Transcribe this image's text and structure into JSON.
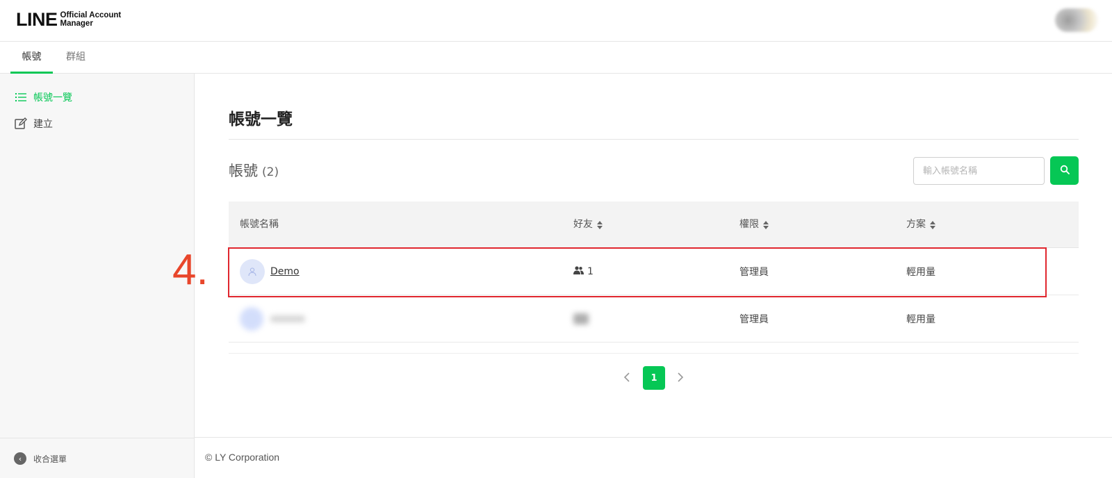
{
  "header": {
    "logo_main": "LINE",
    "logo_sub_line1": "Official Account",
    "logo_sub_line2": "Manager"
  },
  "tabs": [
    {
      "label": "帳號",
      "active": true
    },
    {
      "label": "群組",
      "active": false
    }
  ],
  "sidebar": {
    "items": [
      {
        "label": "帳號一覽",
        "icon": "list-icon",
        "active": true
      },
      {
        "label": "建立",
        "icon": "edit-icon",
        "active": false
      }
    ],
    "collapse_label": "收合選單"
  },
  "main": {
    "page_title": "帳號一覽",
    "section_title": "帳號",
    "section_count": "(2)",
    "search": {
      "placeholder": "輸入帳號名稱",
      "value": ""
    },
    "table": {
      "columns": [
        "帳號名稱",
        "好友",
        "權限",
        "方案"
      ],
      "rows": [
        {
          "name": "Demo",
          "friends": "1",
          "role": "管理員",
          "plan": "輕用量"
        },
        {
          "name": "",
          "friends": "",
          "role": "管理員",
          "plan": "輕用量"
        }
      ]
    },
    "pagination": {
      "current": "1",
      "prev_icon": "chevron-left-icon",
      "next_icon": "chevron-right-icon"
    },
    "annotation": {
      "step": "4."
    }
  },
  "footer": {
    "copyright": "© LY Corporation"
  },
  "colors": {
    "accent": "#06c755",
    "highlight": "#e0262e",
    "step_number": "#e8462b"
  }
}
